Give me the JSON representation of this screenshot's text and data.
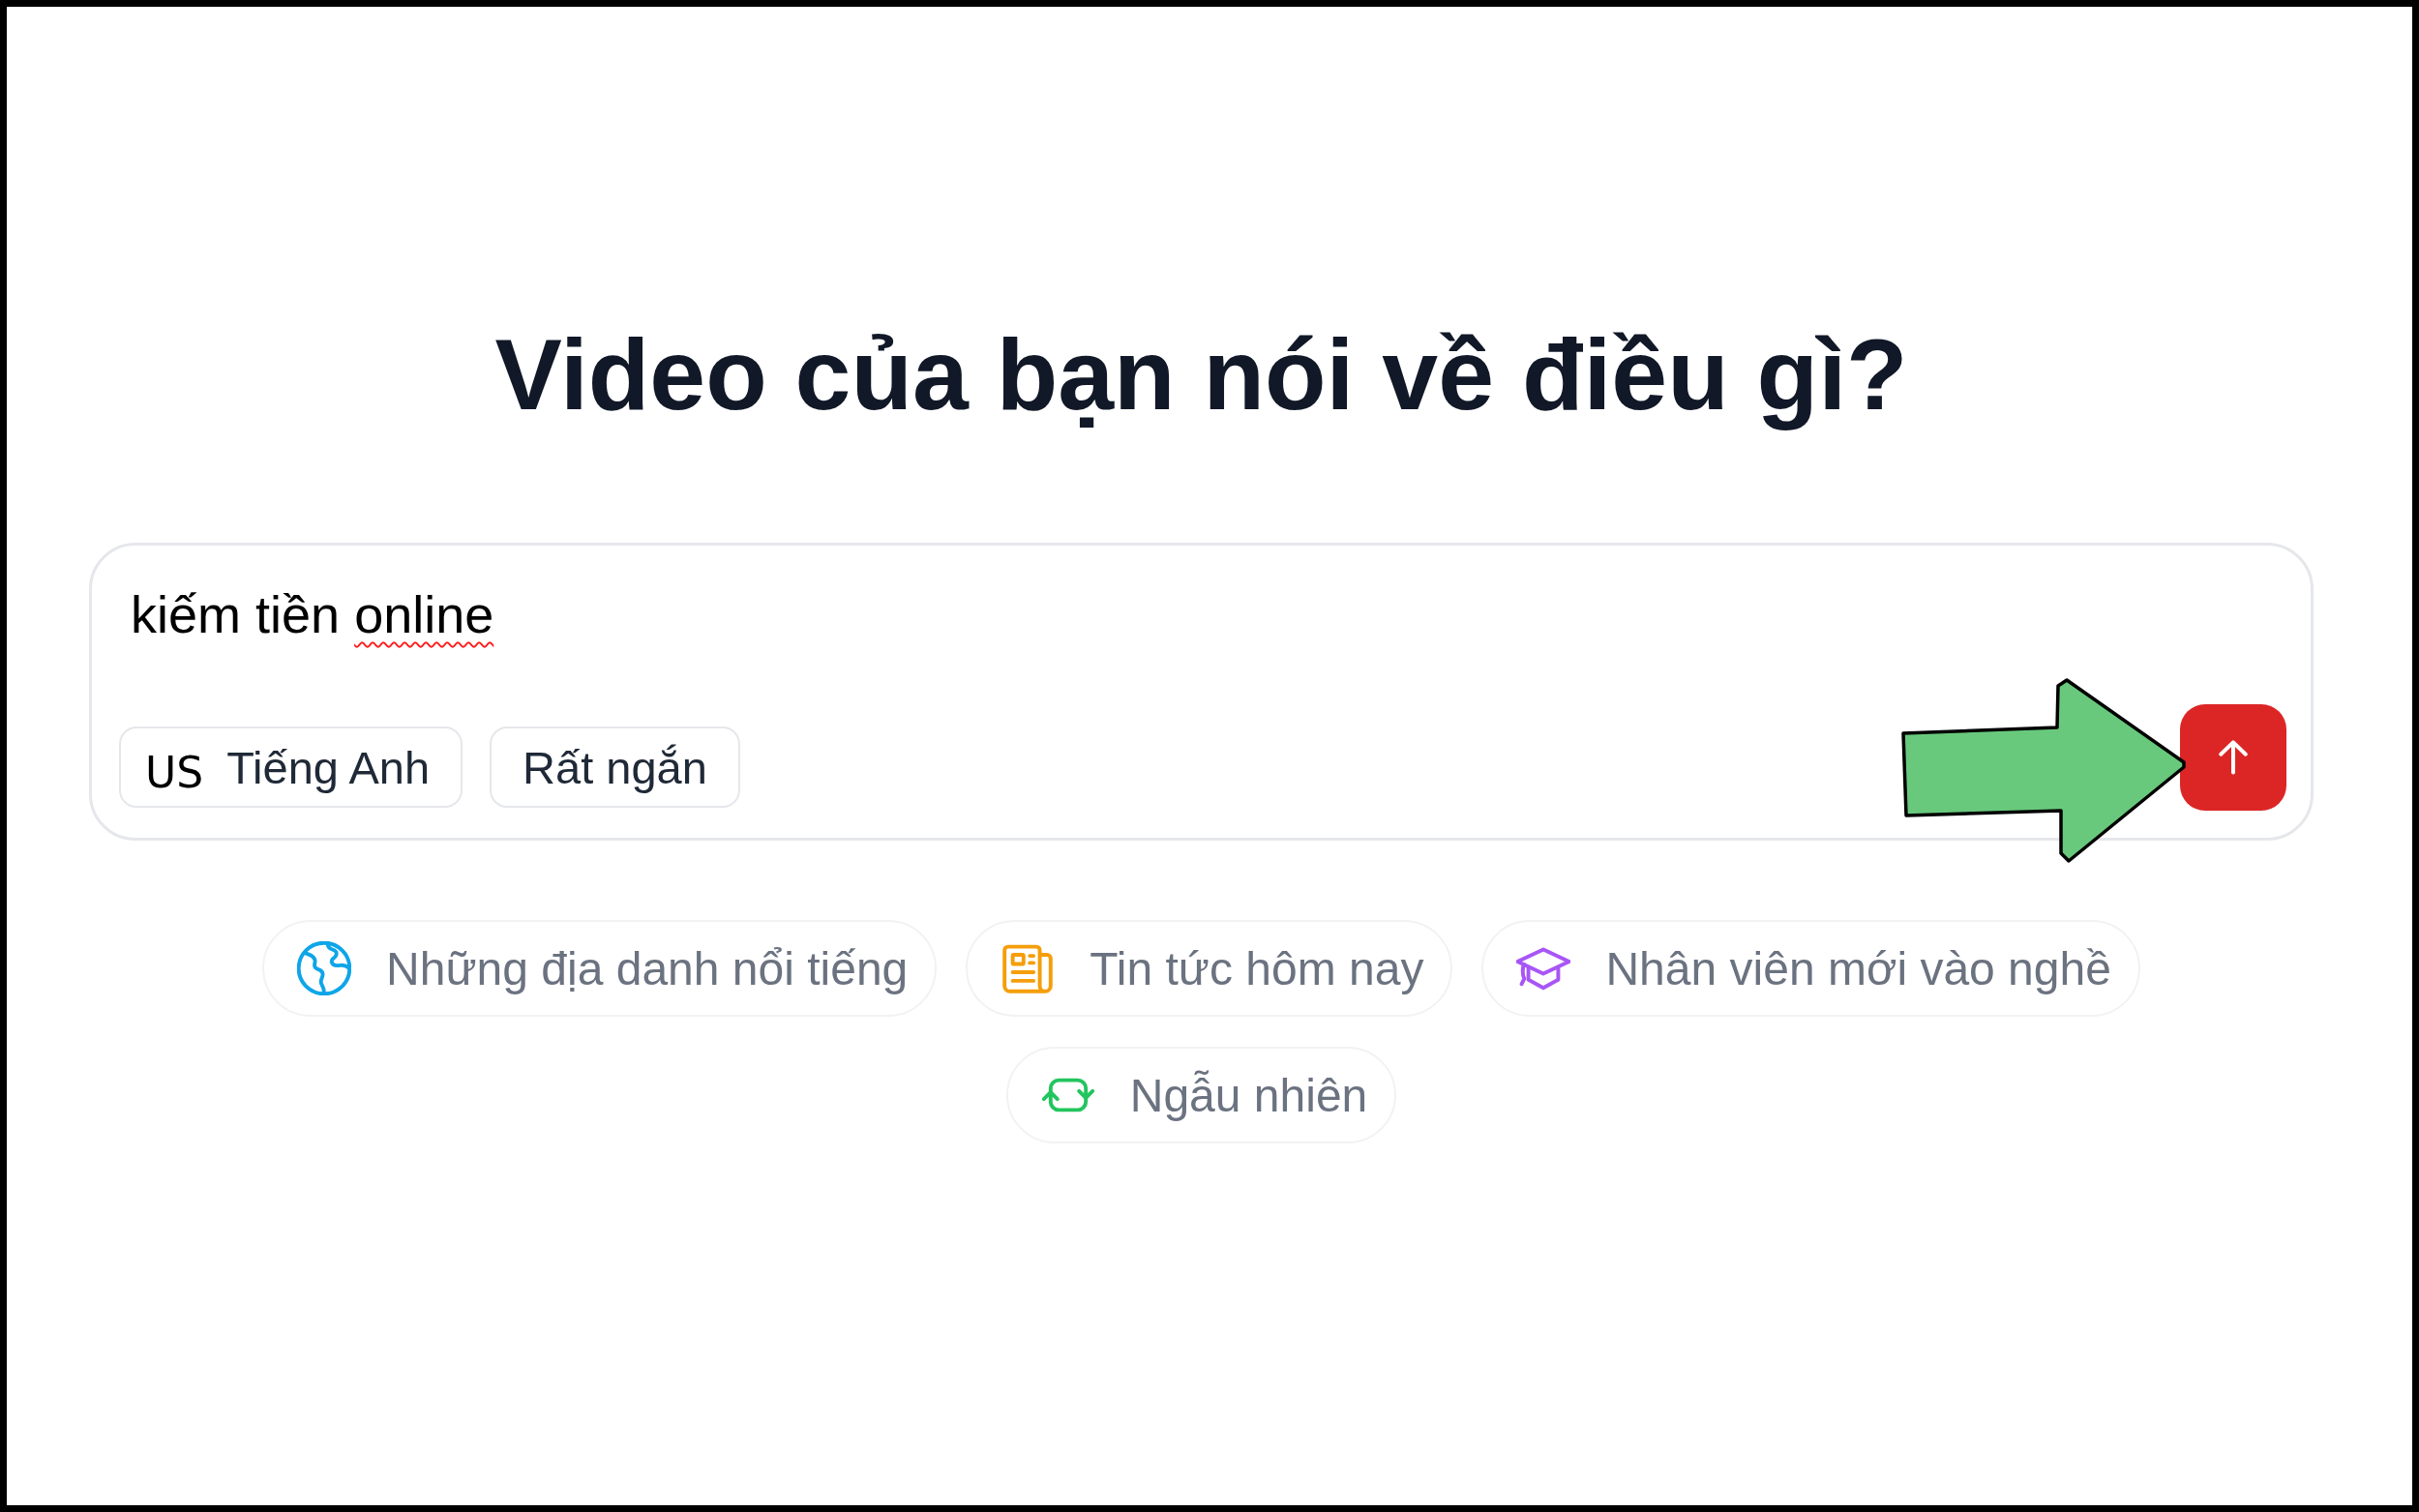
{
  "title": "Video của bạn nói về điều gì?",
  "prompt": {
    "value": [
      {
        "text": "kiếm",
        "misspelled": false
      },
      {
        "text": "tiền",
        "misspelled": false
      },
      {
        "text": "online",
        "misspelled": true
      }
    ],
    "language": {
      "flag": "US",
      "label": "Tiếng Anh"
    },
    "length": {
      "label": "Rất ngắn"
    },
    "send_button": {
      "disabled": false
    }
  },
  "suggestions": [
    {
      "kind": "globe",
      "label": "Những địa danh nổi tiếng",
      "color": "#0ea5e9"
    },
    {
      "kind": "newspaper",
      "label": "Tin tức hôm nay",
      "color": "#f59e0b"
    },
    {
      "kind": "cap",
      "label": "Nhân viên mới vào nghề",
      "color": "#a855f7"
    },
    {
      "kind": "refresh",
      "label": "Ngẫu nhiên",
      "color": "#22c55e"
    }
  ],
  "annotation": {
    "kind": "arrow"
  }
}
